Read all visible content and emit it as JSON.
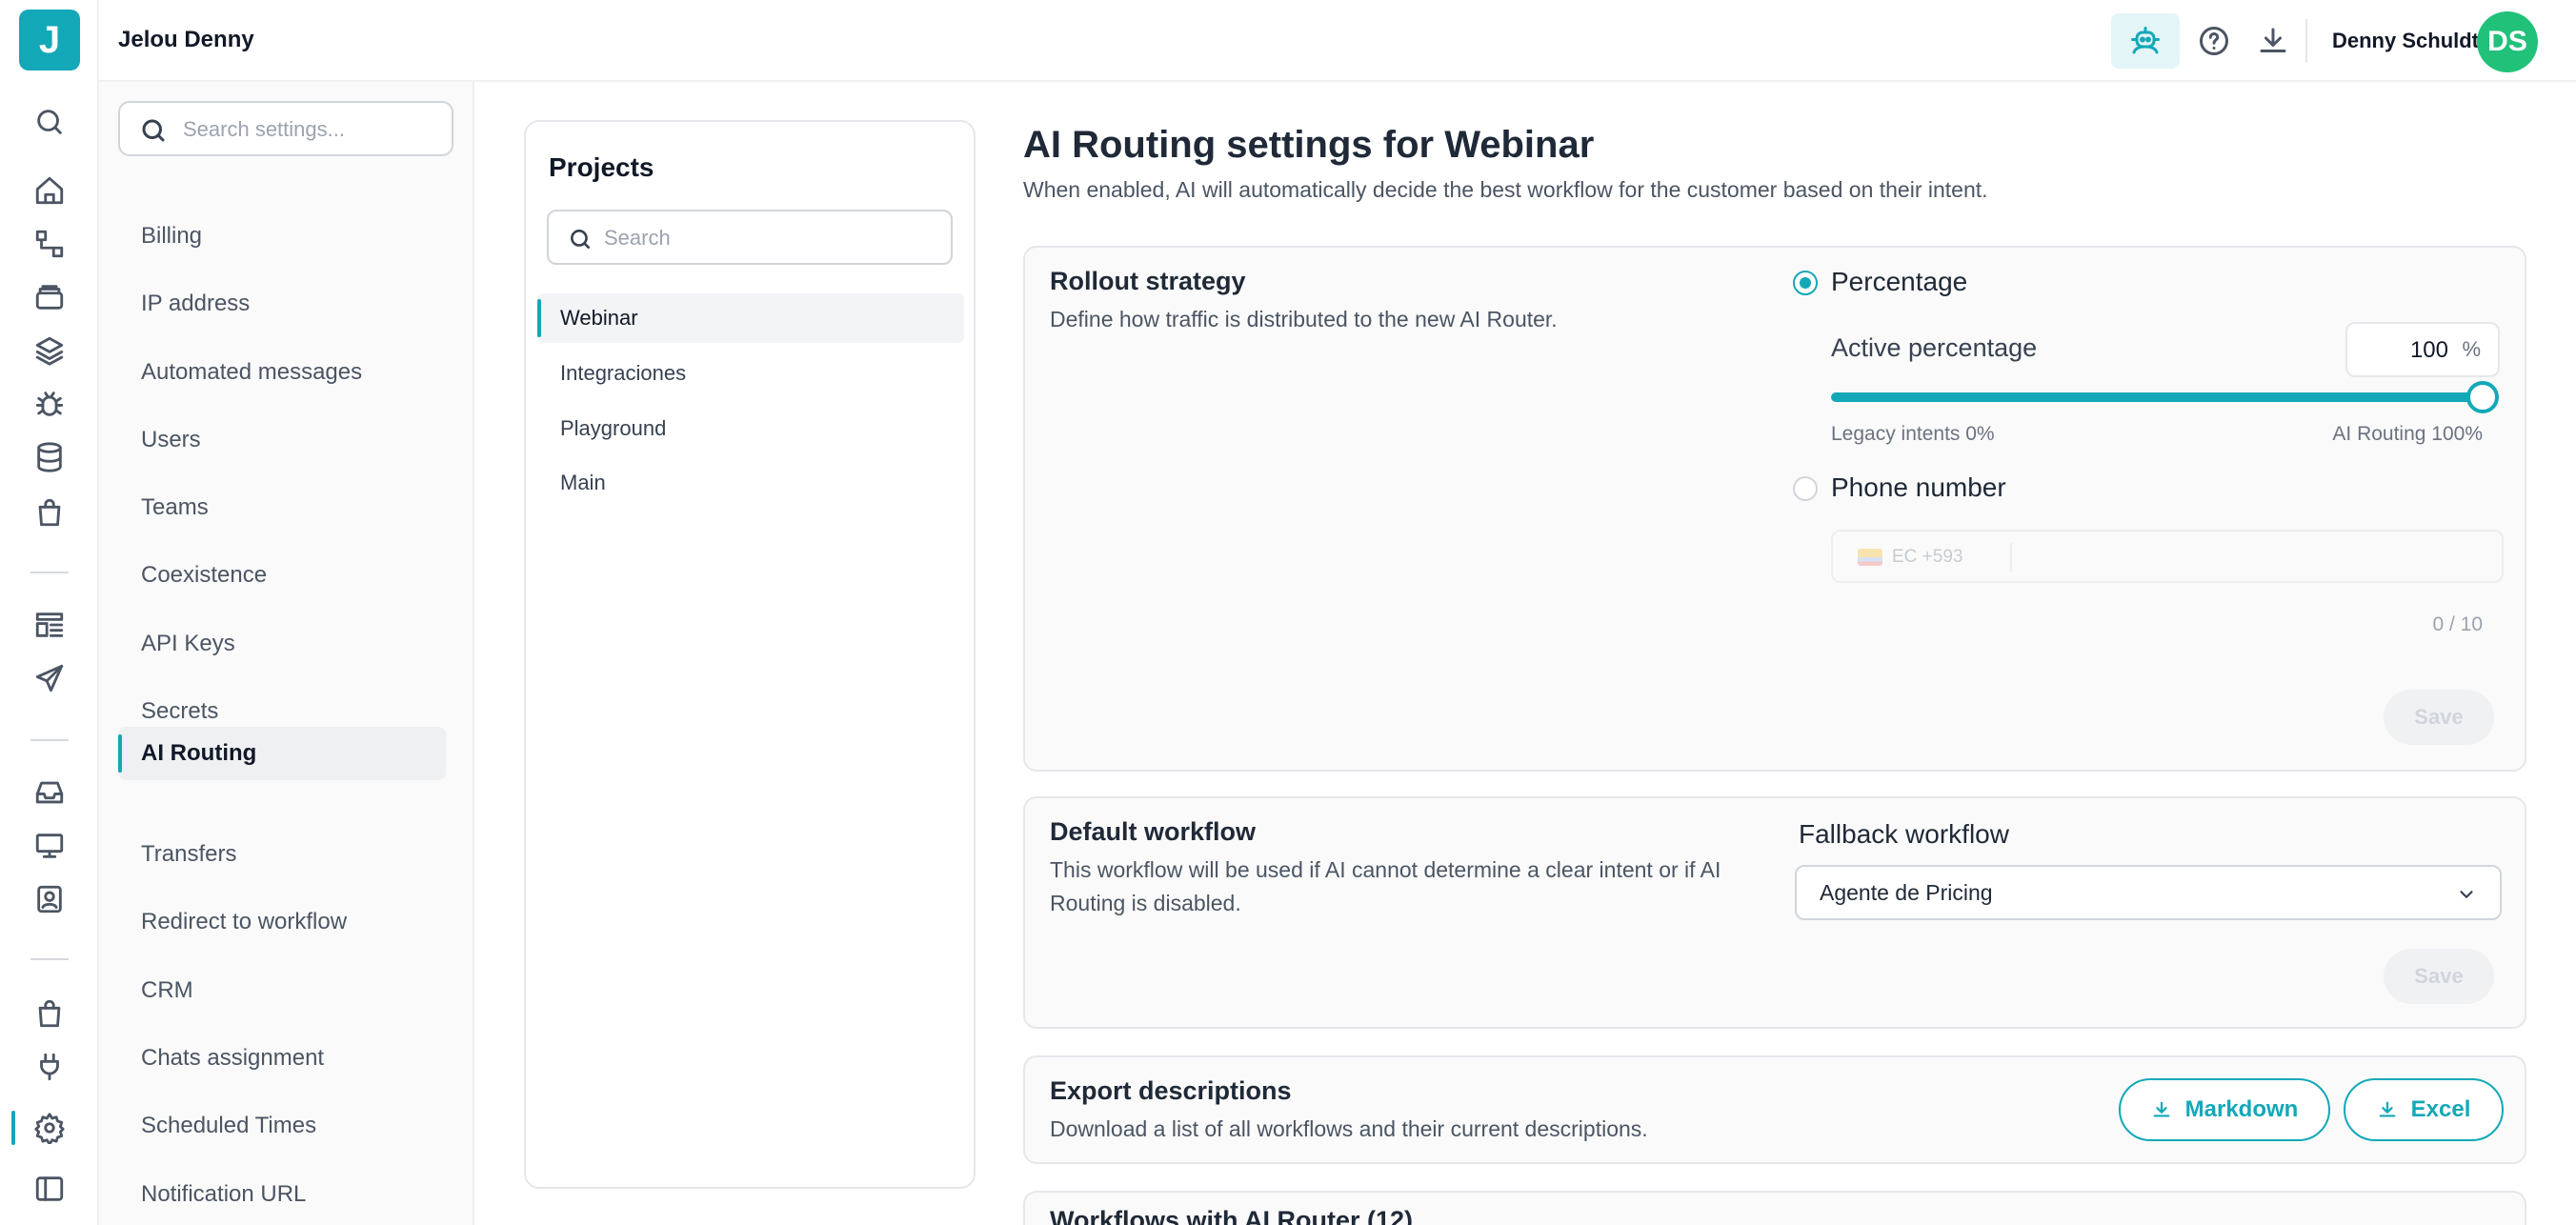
{
  "app": {
    "logo_letter": "J",
    "workspace": "Jelou Denny"
  },
  "header": {
    "user_name": "Denny Schuldt",
    "user_initials": "DS",
    "avatar_color": "#22c17a",
    "accent_color": "#13a8b8"
  },
  "rail": {
    "icons": [
      "search-icon",
      "home-icon",
      "flow-icon",
      "inbox-stack-icon",
      "layers-icon",
      "bug-icon",
      "database-icon",
      "shopping-bag-icon",
      "template-icon",
      "send-icon",
      "inbox-icon",
      "monitor-icon",
      "contact-icon",
      "store-icon",
      "plug-icon",
      "gear-icon",
      "sidebar-toggle-icon"
    ]
  },
  "settings": {
    "search_placeholder": "Search settings...",
    "items": [
      {
        "label": "Billing"
      },
      {
        "label": "IP address"
      },
      {
        "label": "Automated messages"
      },
      {
        "label": "Users"
      },
      {
        "label": "Teams"
      },
      {
        "label": "Coexistence"
      },
      {
        "label": "API Keys"
      },
      {
        "label": "Secrets"
      },
      {
        "label": "AI Routing",
        "active": true
      },
      {
        "label": "Transfers"
      },
      {
        "label": "Redirect to workflow"
      },
      {
        "label": "CRM"
      },
      {
        "label": "Chats assignment"
      },
      {
        "label": "Scheduled Times"
      },
      {
        "label": "Notification URL"
      }
    ]
  },
  "projects": {
    "title": "Projects",
    "search_placeholder": "Search",
    "items": [
      {
        "label": "Webinar",
        "active": true
      },
      {
        "label": "Integraciones"
      },
      {
        "label": "Playground"
      },
      {
        "label": "Main"
      }
    ]
  },
  "page": {
    "title": "AI Routing settings for Webinar",
    "subtitle": "When enabled, AI will automatically decide the best workflow for the customer based on their intent."
  },
  "rollout": {
    "title": "Rollout strategy",
    "description": "Define how traffic is distributed to the new AI Router.",
    "option_percentage": "Percentage",
    "active_percentage_label": "Active percentage",
    "active_percentage_value": "100",
    "percent_unit": "%",
    "slider_value": 100,
    "legacy_label": "Legacy intents 0%",
    "ai_label": "AI Routing 100%",
    "option_phone": "Phone number",
    "phone_code": "EC +593",
    "phone_counter": "0 / 10",
    "save_label": "Save"
  },
  "default_workflow": {
    "title": "Default workflow",
    "description": "This workflow will be used if AI cannot determine a clear intent or if AI Routing is disabled.",
    "fallback_label": "Fallback workflow",
    "fallback_value": "Agente de Pricing",
    "save_label": "Save"
  },
  "export": {
    "title": "Export descriptions",
    "description": "Download a list of all workflows and their current descriptions.",
    "markdown_label": "Markdown",
    "excel_label": "Excel"
  },
  "workflows_section": {
    "title": "Workflows with AI Router (12)"
  }
}
